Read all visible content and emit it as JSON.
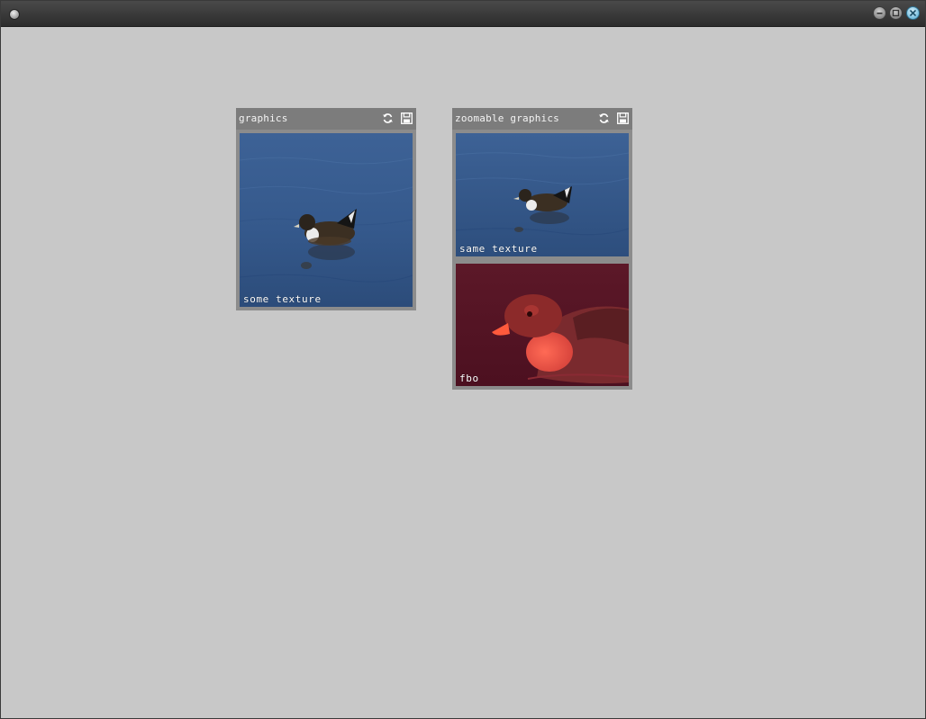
{
  "window": {
    "title": "",
    "controls": [
      "minimize-icon",
      "maximize-icon",
      "close-icon"
    ]
  },
  "panels": [
    {
      "title": "graphics",
      "icons": [
        "refresh-icon",
        "save-icon"
      ],
      "views": [
        {
          "label": "some texture",
          "image": "duck-on-water"
        }
      ]
    },
    {
      "title": "zoomable graphics",
      "icons": [
        "refresh-icon",
        "save-icon"
      ],
      "views": [
        {
          "label": "same texture",
          "image": "duck-on-water"
        },
        {
          "label": "fbo",
          "image": "duck-closeup-red"
        }
      ]
    }
  ],
  "colors": {
    "background": "#c8c8c8",
    "panel_frame": "#8c8c8c",
    "panel_header": "#7c7c7c",
    "water": "#3a5f93",
    "fbo_tint": "#5a1525"
  }
}
